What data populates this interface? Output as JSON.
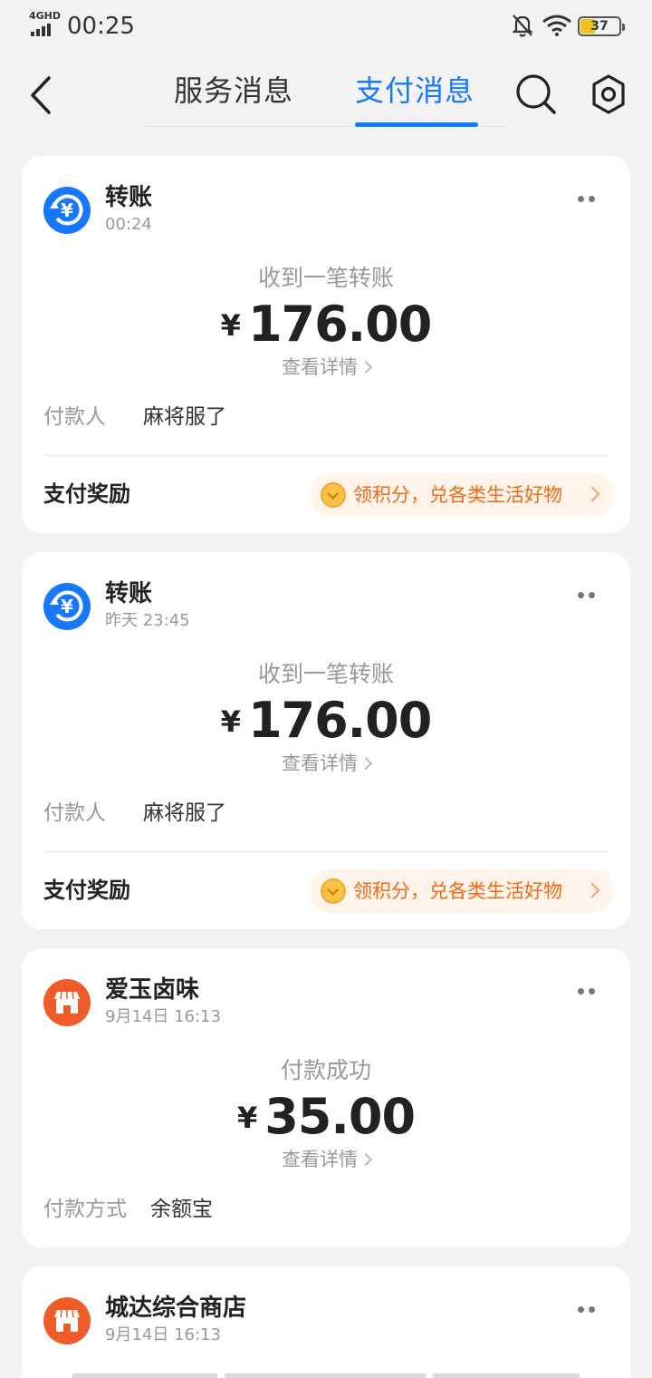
{
  "status_bar": {
    "network": "4GHD",
    "time": "00:25",
    "battery": "37"
  },
  "header": {
    "tabs": [
      {
        "label": "服务消息",
        "active": false
      },
      {
        "label": "支付消息",
        "active": true
      }
    ]
  },
  "colors": {
    "accent": "#1677ff",
    "transfer_icon": "#1677ff",
    "shop_icon": "#ef5c2a",
    "reward_text": "#f06a18"
  },
  "cards": [
    {
      "icon": "yuan-transfer-icon",
      "title": "转账",
      "time": "00:24",
      "subtitle": "收到一笔转账",
      "currency": "¥",
      "amount": "176.00",
      "detail_link": "查看详情",
      "field_label": "付款人",
      "field_value": "麻将服了",
      "reward_label": "支付奖励",
      "reward_text": "领积分，兑各类生活好物"
    },
    {
      "icon": "yuan-transfer-icon",
      "title": "转账",
      "time": "昨天 23:45",
      "subtitle": "收到一笔转账",
      "currency": "¥",
      "amount": "176.00",
      "detail_link": "查看详情",
      "field_label": "付款人",
      "field_value": "麻将服了",
      "reward_label": "支付奖励",
      "reward_text": "领积分，兑各类生活好物"
    },
    {
      "icon": "shop-icon",
      "title": "爱玉卤味",
      "time": "9月14日 16:13",
      "subtitle": "付款成功",
      "currency": "¥",
      "amount": "35.00",
      "detail_link": "查看详情",
      "field_label": "付款方式",
      "field_value": "余额宝"
    },
    {
      "icon": "shop-icon",
      "title": "城达综合商店",
      "time": "9月14日 16:13"
    }
  ]
}
